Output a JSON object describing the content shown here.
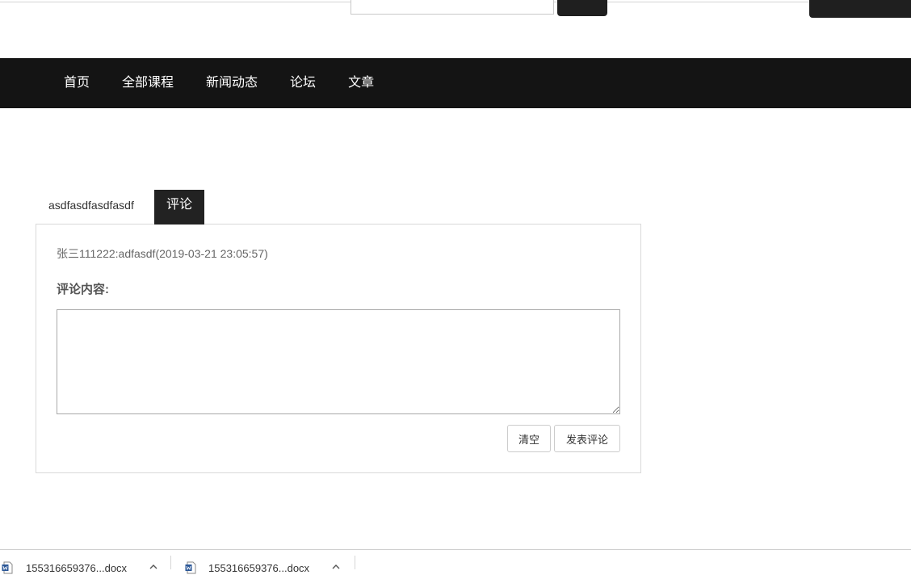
{
  "nav": {
    "items": [
      {
        "label": "首页"
      },
      {
        "label": "全部课程"
      },
      {
        "label": "新闻动态"
      },
      {
        "label": "论坛"
      },
      {
        "label": "文章"
      }
    ]
  },
  "tabs": [
    {
      "label": "asdfasdfasdfasdf",
      "active": false
    },
    {
      "label": "评论",
      "active": true
    }
  ],
  "comments": [
    {
      "text": "张三111222:adfasdf(2019-03-21 23:05:57)"
    }
  ],
  "form": {
    "label": "评论内容:",
    "clear_label": "清空",
    "submit_label": "发表评论"
  },
  "downloads": [
    {
      "filename": "155316659376...docx",
      "icon": "word-document-icon"
    },
    {
      "filename": "155316659376...docx",
      "icon": "word-document-icon"
    }
  ],
  "colors": {
    "nav_bg": "#141414",
    "tab_active_bg": "#222222",
    "border": "#d9d9d9"
  }
}
